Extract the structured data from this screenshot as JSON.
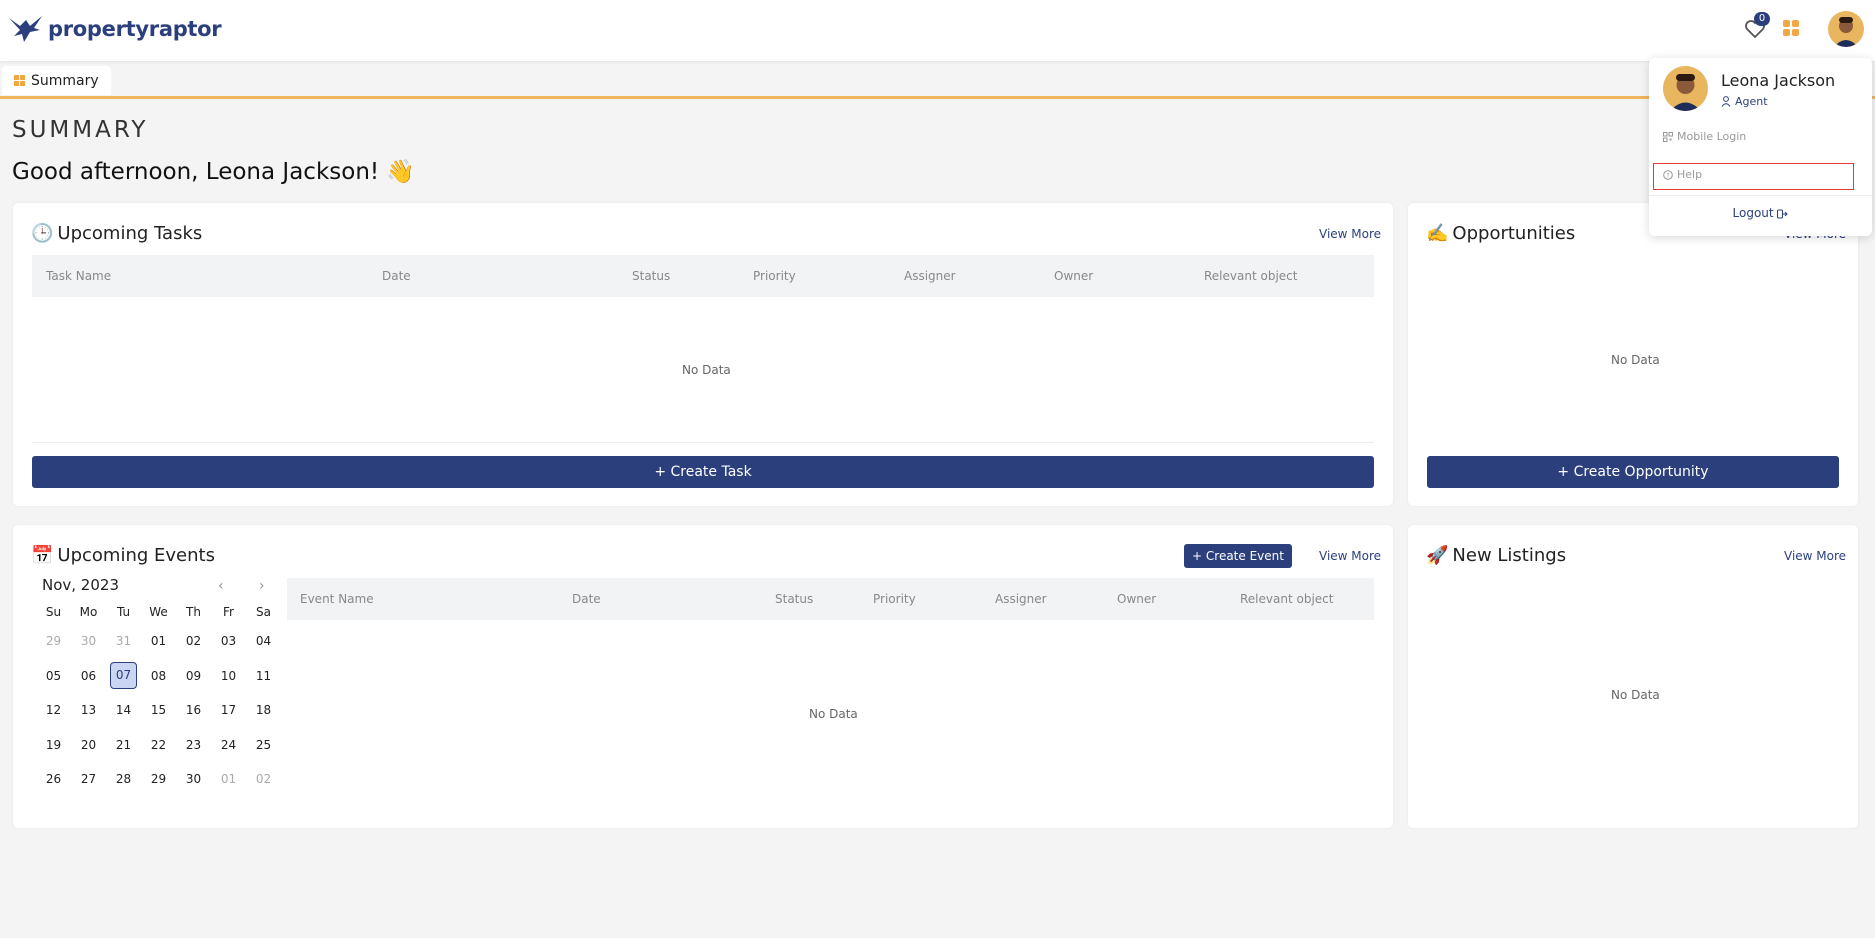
{
  "header": {
    "brand": "propertyraptor",
    "wishlist_count": "0"
  },
  "tabs": [
    {
      "label": "Summary"
    }
  ],
  "page": {
    "title": "SUMMARY",
    "greeting": "Good afternoon, Leona Jackson! 👋"
  },
  "tasks": {
    "title": "Upcoming Tasks",
    "emoji": "🕒",
    "view_more": "View More",
    "columns": [
      "Task Name",
      "Date",
      "Status",
      "Priority",
      "Assigner",
      "Owner",
      "Relevant object"
    ],
    "empty": "No Data",
    "create_button": "+ Create Task"
  },
  "opportunities": {
    "title": "Opportunities",
    "emoji": "✍️",
    "view_more": "View More",
    "empty": "No Data",
    "create_button": "+ Create Opportunity"
  },
  "events": {
    "title": "Upcoming Events",
    "emoji": "📅",
    "create_button": "+ Create Event",
    "view_more": "View More",
    "columns": [
      "Event Name",
      "Date",
      "Status",
      "Priority",
      "Assigner",
      "Owner",
      "Relevant object"
    ],
    "empty": "No Data",
    "calendar": {
      "month": "Nov, 2023",
      "prev": "‹",
      "next": "›",
      "weekdays": [
        "Su",
        "Mo",
        "Tu",
        "We",
        "Th",
        "Fr",
        "Sa"
      ],
      "weeks": [
        [
          "29",
          "30",
          "31",
          "01",
          "02",
          "03",
          "04"
        ],
        [
          "05",
          "06",
          "07",
          "08",
          "09",
          "10",
          "11"
        ],
        [
          "12",
          "13",
          "14",
          "15",
          "16",
          "17",
          "18"
        ],
        [
          "19",
          "20",
          "21",
          "22",
          "23",
          "24",
          "25"
        ],
        [
          "26",
          "27",
          "28",
          "29",
          "30",
          "01",
          "02"
        ]
      ],
      "selected": "07"
    }
  },
  "listings": {
    "title": "New Listings",
    "emoji": "🚀",
    "view_more": "View More",
    "empty": "No Data"
  },
  "user_menu": {
    "name": "Leona Jackson",
    "role": "Agent",
    "items": [
      {
        "label": "Mobile Login"
      },
      {
        "label": "Help"
      }
    ],
    "logout": "Logout"
  },
  "colors": {
    "primary": "#2b3f7d",
    "accent": "#f0a844",
    "highlight": "#e53935"
  }
}
